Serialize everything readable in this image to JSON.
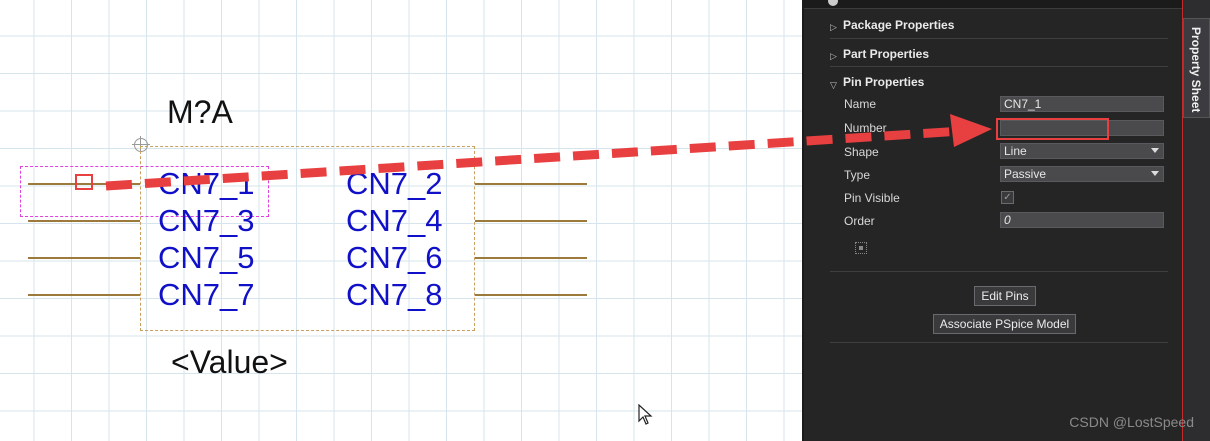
{
  "schematic": {
    "reference": "M?A",
    "value": "<Value>",
    "pins": [
      "CN7_1",
      "CN7_2",
      "CN7_3",
      "CN7_4",
      "CN7_5",
      "CN7_6",
      "CN7_7",
      "CN7_8"
    ]
  },
  "panel": {
    "sections": {
      "package": "Package Properties",
      "part": "Part Properties",
      "pin": "Pin Properties"
    },
    "labels": {
      "name": "Name",
      "number": "Number",
      "shape": "Shape",
      "type": "Type",
      "pin_visible": "Pin Visible",
      "order": "Order"
    },
    "values": {
      "name": "CN7_1",
      "number": "",
      "shape": "Line",
      "type": "Passive",
      "order": "0"
    },
    "buttons": {
      "edit_pins": "Edit Pins",
      "associate_pspice": "Associate PSpice Model"
    },
    "sidebar_tab": "Property Sheet"
  },
  "watermark": "CSDN @LostSpeed",
  "colors": {
    "pin_label": "#1010c8",
    "annotation": "#e84040",
    "panel_bg": "#252526"
  }
}
